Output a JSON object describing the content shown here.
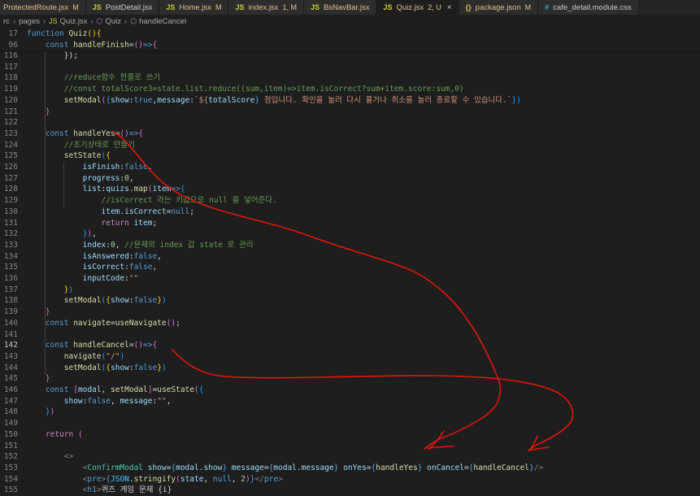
{
  "tabs": [
    {
      "icon": "",
      "label": "ProtectedRoute.jsx",
      "badge": "M",
      "color": "#e2c08d",
      "active": false
    },
    {
      "icon": "JS",
      "label": "PostDetail.jsx",
      "badge": "",
      "color": "#cccccc",
      "active": false
    },
    {
      "icon": "JS",
      "label": "Home.jsx",
      "badge": "M",
      "color": "#e2c08d",
      "active": false
    },
    {
      "icon": "JS",
      "label": "index.jsx",
      "badge": "1, M",
      "color": "#e2c08d",
      "active": false
    },
    {
      "icon": "JS",
      "label": "BsNavBar.jsx",
      "badge": "",
      "color": "#e2c08d",
      "active": false
    },
    {
      "icon": "JS",
      "label": "Quiz.jsx",
      "badge": "2, U",
      "color": "#e2c08d",
      "active": true,
      "close": "×"
    },
    {
      "icon": "{}",
      "label": "package.json",
      "badge": "M",
      "color": "#e2c08d",
      "active": false
    },
    {
      "icon": "#",
      "label": "cafe_detail.module.css",
      "badge": "",
      "color": "#cccccc",
      "active": false
    }
  ],
  "breadcrumb": [
    {
      "icon": "",
      "label": "rc"
    },
    {
      "icon": "",
      "label": "pages"
    },
    {
      "icon": "JS",
      "label": "Quiz.jsx"
    },
    {
      "icon": "⬡",
      "label": "Quiz"
    },
    {
      "icon": "⬡",
      "label": "handleCancel"
    }
  ],
  "sticky": [
    {
      "n": "17",
      "t": [
        [
          "function ",
          "kw"
        ],
        [
          "Quiz",
          "fn"
        ],
        [
          "(){",
          "br"
        ]
      ]
    },
    {
      "n": "96",
      "t": [
        [
          "    const ",
          "kw"
        ],
        [
          "handleFinish",
          "fn"
        ],
        [
          "=",
          "plain"
        ],
        [
          "()",
          "br2"
        ],
        [
          "=>",
          "kw"
        ],
        [
          "{",
          "br2"
        ]
      ]
    }
  ],
  "lines": [
    {
      "n": "116",
      "t": [
        [
          "        })",
          "plain"
        ],
        [
          ";",
          "plain"
        ]
      ]
    },
    {
      "n": "117",
      "t": []
    },
    {
      "n": "118",
      "t": [
        [
          "        //reduce함수 한줄로 쓰기",
          "cm"
        ]
      ]
    },
    {
      "n": "119",
      "t": [
        [
          "        //const totalScore3=state.list.reduce((sum,item)=>item.isCorrect?sum+item.score:sum,0)",
          "cm"
        ]
      ]
    },
    {
      "n": "120",
      "t": [
        [
          "        ",
          "plain"
        ],
        [
          "setModal",
          "fn"
        ],
        [
          "(",
          "br2"
        ],
        [
          "{",
          "br3"
        ],
        [
          "show",
          "var"
        ],
        [
          ":",
          "plain"
        ],
        [
          "true",
          "kw"
        ],
        [
          ",",
          "plain"
        ],
        [
          "message",
          "var"
        ],
        [
          ":",
          "plain"
        ],
        [
          "`${",
          "str"
        ],
        [
          "totalScore",
          "var"
        ],
        [
          "}",
          "kw"
        ],
        [
          " 점입니다. 확인을 눌러 다시 풀거나 취소를 눌러 종료할 수 있습니다.`",
          "str"
        ],
        [
          "})",
          "br3"
        ]
      ]
    },
    {
      "n": "121",
      "t": [
        [
          "    }",
          "br2"
        ]
      ]
    },
    {
      "n": "122",
      "t": []
    },
    {
      "n": "123",
      "t": [
        [
          "    const ",
          "kw"
        ],
        [
          "handleYes",
          "fn"
        ],
        [
          "=",
          "plain"
        ],
        [
          "()",
          "br2"
        ],
        [
          "=>",
          "kw"
        ],
        [
          "{",
          "br2"
        ]
      ]
    },
    {
      "n": "124",
      "t": [
        [
          "        //초기상태로 만들기",
          "cm"
        ]
      ]
    },
    {
      "n": "125",
      "t": [
        [
          "        ",
          "plain"
        ],
        [
          "setState",
          "fn"
        ],
        [
          "(",
          "br3"
        ],
        [
          "{",
          "br"
        ]
      ]
    },
    {
      "n": "126",
      "t": [
        [
          "            ",
          "plain"
        ],
        [
          "isFinish",
          "var"
        ],
        [
          ":",
          "plain"
        ],
        [
          "false",
          "kw"
        ],
        [
          ",",
          "plain"
        ]
      ]
    },
    {
      "n": "127",
      "t": [
        [
          "            ",
          "plain"
        ],
        [
          "progress",
          "var"
        ],
        [
          ":",
          "plain"
        ],
        [
          "0",
          "num"
        ],
        [
          ",",
          "plain"
        ]
      ]
    },
    {
      "n": "128",
      "t": [
        [
          "            ",
          "plain"
        ],
        [
          "list",
          "var"
        ],
        [
          ":",
          "plain"
        ],
        [
          "quizs",
          "var"
        ],
        [
          ".",
          "plain"
        ],
        [
          "map",
          "fn"
        ],
        [
          "(",
          "br2"
        ],
        [
          "item",
          "var"
        ],
        [
          "=>",
          "kw"
        ],
        [
          "{",
          "br3"
        ]
      ]
    },
    {
      "n": "129",
      "t": [
        [
          "                //isCorrect 라는 키값으로 null 을 넣어준다.",
          "cm"
        ]
      ]
    },
    {
      "n": "130",
      "t": [
        [
          "                ",
          "plain"
        ],
        [
          "item",
          "var"
        ],
        [
          ".",
          "plain"
        ],
        [
          "isCorrect",
          "var"
        ],
        [
          "=",
          "plain"
        ],
        [
          "null",
          "kw"
        ],
        [
          ";",
          "plain"
        ]
      ]
    },
    {
      "n": "131",
      "t": [
        [
          "                ",
          "plain"
        ],
        [
          "return ",
          "ctl"
        ],
        [
          "item",
          "var"
        ],
        [
          ";",
          "plain"
        ]
      ]
    },
    {
      "n": "132",
      "t": [
        [
          "            ",
          "plain"
        ],
        [
          "}",
          "br3"
        ],
        [
          ")",
          "br2"
        ],
        [
          ",",
          "plain"
        ]
      ]
    },
    {
      "n": "133",
      "t": [
        [
          "            ",
          "plain"
        ],
        [
          "index",
          "var"
        ],
        [
          ":",
          "plain"
        ],
        [
          "0",
          "num"
        ],
        [
          ", ",
          "plain"
        ],
        [
          "//문제의 index 값 state 로 관리",
          "cm"
        ]
      ]
    },
    {
      "n": "134",
      "t": [
        [
          "            ",
          "plain"
        ],
        [
          "isAnswered",
          "var"
        ],
        [
          ":",
          "plain"
        ],
        [
          "false",
          "kw"
        ],
        [
          ",",
          "plain"
        ]
      ]
    },
    {
      "n": "135",
      "t": [
        [
          "            ",
          "plain"
        ],
        [
          "isCorrect",
          "var"
        ],
        [
          ":",
          "plain"
        ],
        [
          "false",
          "kw"
        ],
        [
          ",",
          "plain"
        ]
      ]
    },
    {
      "n": "136",
      "t": [
        [
          "            ",
          "plain"
        ],
        [
          "inputCode",
          "var"
        ],
        [
          ":",
          "plain"
        ],
        [
          "\"\"",
          "str"
        ]
      ]
    },
    {
      "n": "137",
      "t": [
        [
          "        ",
          "plain"
        ],
        [
          "}",
          "br"
        ],
        [
          ")",
          "br3"
        ]
      ]
    },
    {
      "n": "138",
      "t": [
        [
          "        ",
          "plain"
        ],
        [
          "setModal",
          "fn"
        ],
        [
          "(",
          "br3"
        ],
        [
          "{",
          "br"
        ],
        [
          "show",
          "var"
        ],
        [
          ":",
          "plain"
        ],
        [
          "false",
          "kw"
        ],
        [
          "}",
          "br"
        ],
        [
          ")",
          "br3"
        ]
      ]
    },
    {
      "n": "139",
      "t": [
        [
          "    }",
          "br2"
        ]
      ]
    },
    {
      "n": "140",
      "t": [
        [
          "    const ",
          "kw"
        ],
        [
          "navigate",
          "fn"
        ],
        [
          "=",
          "plain"
        ],
        [
          "useNavigate",
          "fn"
        ],
        [
          "()",
          "br2"
        ],
        [
          ";",
          "plain"
        ]
      ]
    },
    {
      "n": "141",
      "t": []
    },
    {
      "n": "142",
      "t": [
        [
          "    const ",
          "kw"
        ],
        [
          "handleCancel",
          "fn"
        ],
        [
          "=",
          "plain"
        ],
        [
          "()",
          "br2"
        ],
        [
          "=>",
          "kw"
        ],
        [
          "{",
          "br2"
        ]
      ]
    },
    {
      "n": "143",
      "t": [
        [
          "        ",
          "plain"
        ],
        [
          "navigate",
          "fn"
        ],
        [
          "(",
          "br3"
        ],
        [
          "\"/\"",
          "str"
        ],
        [
          ")",
          "br3"
        ]
      ]
    },
    {
      "n": "144",
      "t": [
        [
          "        ",
          "plain"
        ],
        [
          "setModal",
          "fn"
        ],
        [
          "(",
          "br3"
        ],
        [
          "{",
          "br"
        ],
        [
          "show",
          "var"
        ],
        [
          ":",
          "plain"
        ],
        [
          "false",
          "kw"
        ],
        [
          "}",
          "br"
        ],
        [
          ")",
          "br3"
        ]
      ]
    },
    {
      "n": "145",
      "t": [
        [
          "    }",
          "br2"
        ]
      ]
    },
    {
      "n": "146",
      "t": [
        [
          "    const ",
          "kw"
        ],
        [
          "[",
          "br2"
        ],
        [
          "modal",
          "var"
        ],
        [
          ", ",
          "plain"
        ],
        [
          "setModal",
          "fn"
        ],
        [
          "]",
          "br2"
        ],
        [
          "=",
          "plain"
        ],
        [
          "useState",
          "fn"
        ],
        [
          "(",
          "br2"
        ],
        [
          "{",
          "br3"
        ]
      ]
    },
    {
      "n": "147",
      "t": [
        [
          "        ",
          "plain"
        ],
        [
          "show",
          "var"
        ],
        [
          ":",
          "plain"
        ],
        [
          "false",
          "kw"
        ],
        [
          ", ",
          "plain"
        ],
        [
          "message",
          "var"
        ],
        [
          ":",
          "plain"
        ],
        [
          "\"\"",
          "str"
        ],
        [
          ",",
          "plain"
        ]
      ]
    },
    {
      "n": "148",
      "t": [
        [
          "    ",
          "plain"
        ],
        [
          "}",
          "br3"
        ],
        [
          ")",
          "br2"
        ]
      ]
    },
    {
      "n": "149",
      "t": []
    },
    {
      "n": "150",
      "t": [
        [
          "    ",
          "plain"
        ],
        [
          "return ",
          "ctl"
        ],
        [
          "(",
          "br2"
        ]
      ]
    },
    {
      "n": "151",
      "t": []
    },
    {
      "n": "152",
      "t": [
        [
          "        ",
          "plain"
        ],
        [
          "<>",
          "tagb"
        ]
      ]
    },
    {
      "n": "153",
      "t": [
        [
          "            ",
          "plain"
        ],
        [
          "<",
          "tagb"
        ],
        [
          "ConfirmModal ",
          "tag"
        ],
        [
          "show",
          "var"
        ],
        [
          "=",
          "plain"
        ],
        [
          "{",
          "kw"
        ],
        [
          "modal",
          "var"
        ],
        [
          ".",
          "plain"
        ],
        [
          "show",
          "var"
        ],
        [
          "}",
          "kw"
        ],
        [
          " message",
          "var"
        ],
        [
          "=",
          "plain"
        ],
        [
          "{",
          "kw"
        ],
        [
          "modal",
          "var"
        ],
        [
          ".",
          "plain"
        ],
        [
          "message",
          "var"
        ],
        [
          "}",
          "kw"
        ],
        [
          " onYes",
          "var"
        ],
        [
          "=",
          "plain"
        ],
        [
          "{",
          "kw"
        ],
        [
          "handleYes",
          "fn"
        ],
        [
          "}",
          "kw"
        ],
        [
          " onCancel",
          "var"
        ],
        [
          "=",
          "plain"
        ],
        [
          "{",
          "kw"
        ],
        [
          "handleCancel",
          "fn"
        ],
        [
          "}",
          "kw"
        ],
        [
          "/>",
          "tagb"
        ]
      ]
    },
    {
      "n": "154",
      "t": [
        [
          "            ",
          "plain"
        ],
        [
          "<",
          "tagb"
        ],
        [
          "pre",
          "kw"
        ],
        [
          ">",
          "tagb"
        ],
        [
          "{",
          "kw"
        ],
        [
          "JSON",
          "con"
        ],
        [
          ".",
          "plain"
        ],
        [
          "stringify",
          "fn"
        ],
        [
          "(",
          "br2"
        ],
        [
          "state",
          "var"
        ],
        [
          ", ",
          "plain"
        ],
        [
          "null",
          "kw"
        ],
        [
          ", ",
          "plain"
        ],
        [
          "2",
          "num"
        ],
        [
          ")",
          "br2"
        ],
        [
          "}",
          "kw"
        ],
        [
          "</",
          "tagb"
        ],
        [
          "pre",
          "kw"
        ],
        [
          ">",
          "tagb"
        ]
      ]
    },
    {
      "n": "155",
      "t": [
        [
          "            ",
          "plain"
        ],
        [
          "<",
          "tagb"
        ],
        [
          "h1",
          "kw"
        ],
        [
          ">",
          "tagb"
        ],
        [
          "퀴즈 게임 문제 {i}",
          "plain"
        ]
      ]
    }
  ],
  "current_line": "142"
}
